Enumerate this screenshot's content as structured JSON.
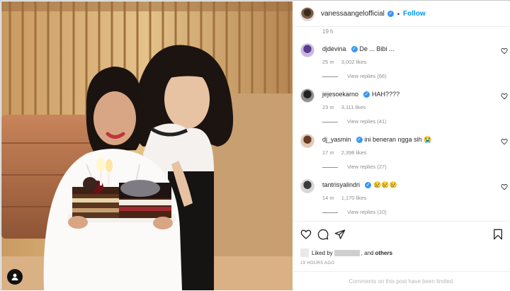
{
  "header": {
    "username": "vanessaangelofficial",
    "separator": "•",
    "follow_label": "Follow",
    "verified_mark": "✓"
  },
  "post_time_short": "19 h",
  "comments": [
    {
      "username": "djdevina",
      "verified": true,
      "text": "De ... Bibi ...",
      "time": "25 m",
      "likes": "3,002 likes",
      "replies": "View replies (66)"
    },
    {
      "username": "jejesoekarno",
      "verified": true,
      "text": "HAH????",
      "time": "23 m",
      "likes": "3,111 likes",
      "replies": "View replies (41)"
    },
    {
      "username": "dj_yasmin",
      "verified": true,
      "text": "ini beneran ngga sih 😭",
      "time": "17 m",
      "likes": "2,398 likes",
      "replies": "View replies (27)"
    },
    {
      "username": "tantrisyalindri",
      "verified": true,
      "text": "😢😢😢",
      "time": "14 m",
      "likes": "1,170 likes",
      "replies": "View replies (10)"
    }
  ],
  "liked_by": {
    "prefix": "Liked by",
    "conjunction": ", and",
    "others": "others"
  },
  "post_time": "19 HOURS AGO",
  "comments_limited": "Comments on this post have been limited.",
  "icons": {
    "like": "heart-outline-icon",
    "comment": "speech-bubble-icon",
    "share": "paper-plane-icon",
    "save": "bookmark-icon",
    "user_tag": "person-icon"
  },
  "colors": {
    "accent": "#0095f6",
    "verified": "#3897f0",
    "text": "#262626",
    "muted": "#8e8e8e"
  }
}
